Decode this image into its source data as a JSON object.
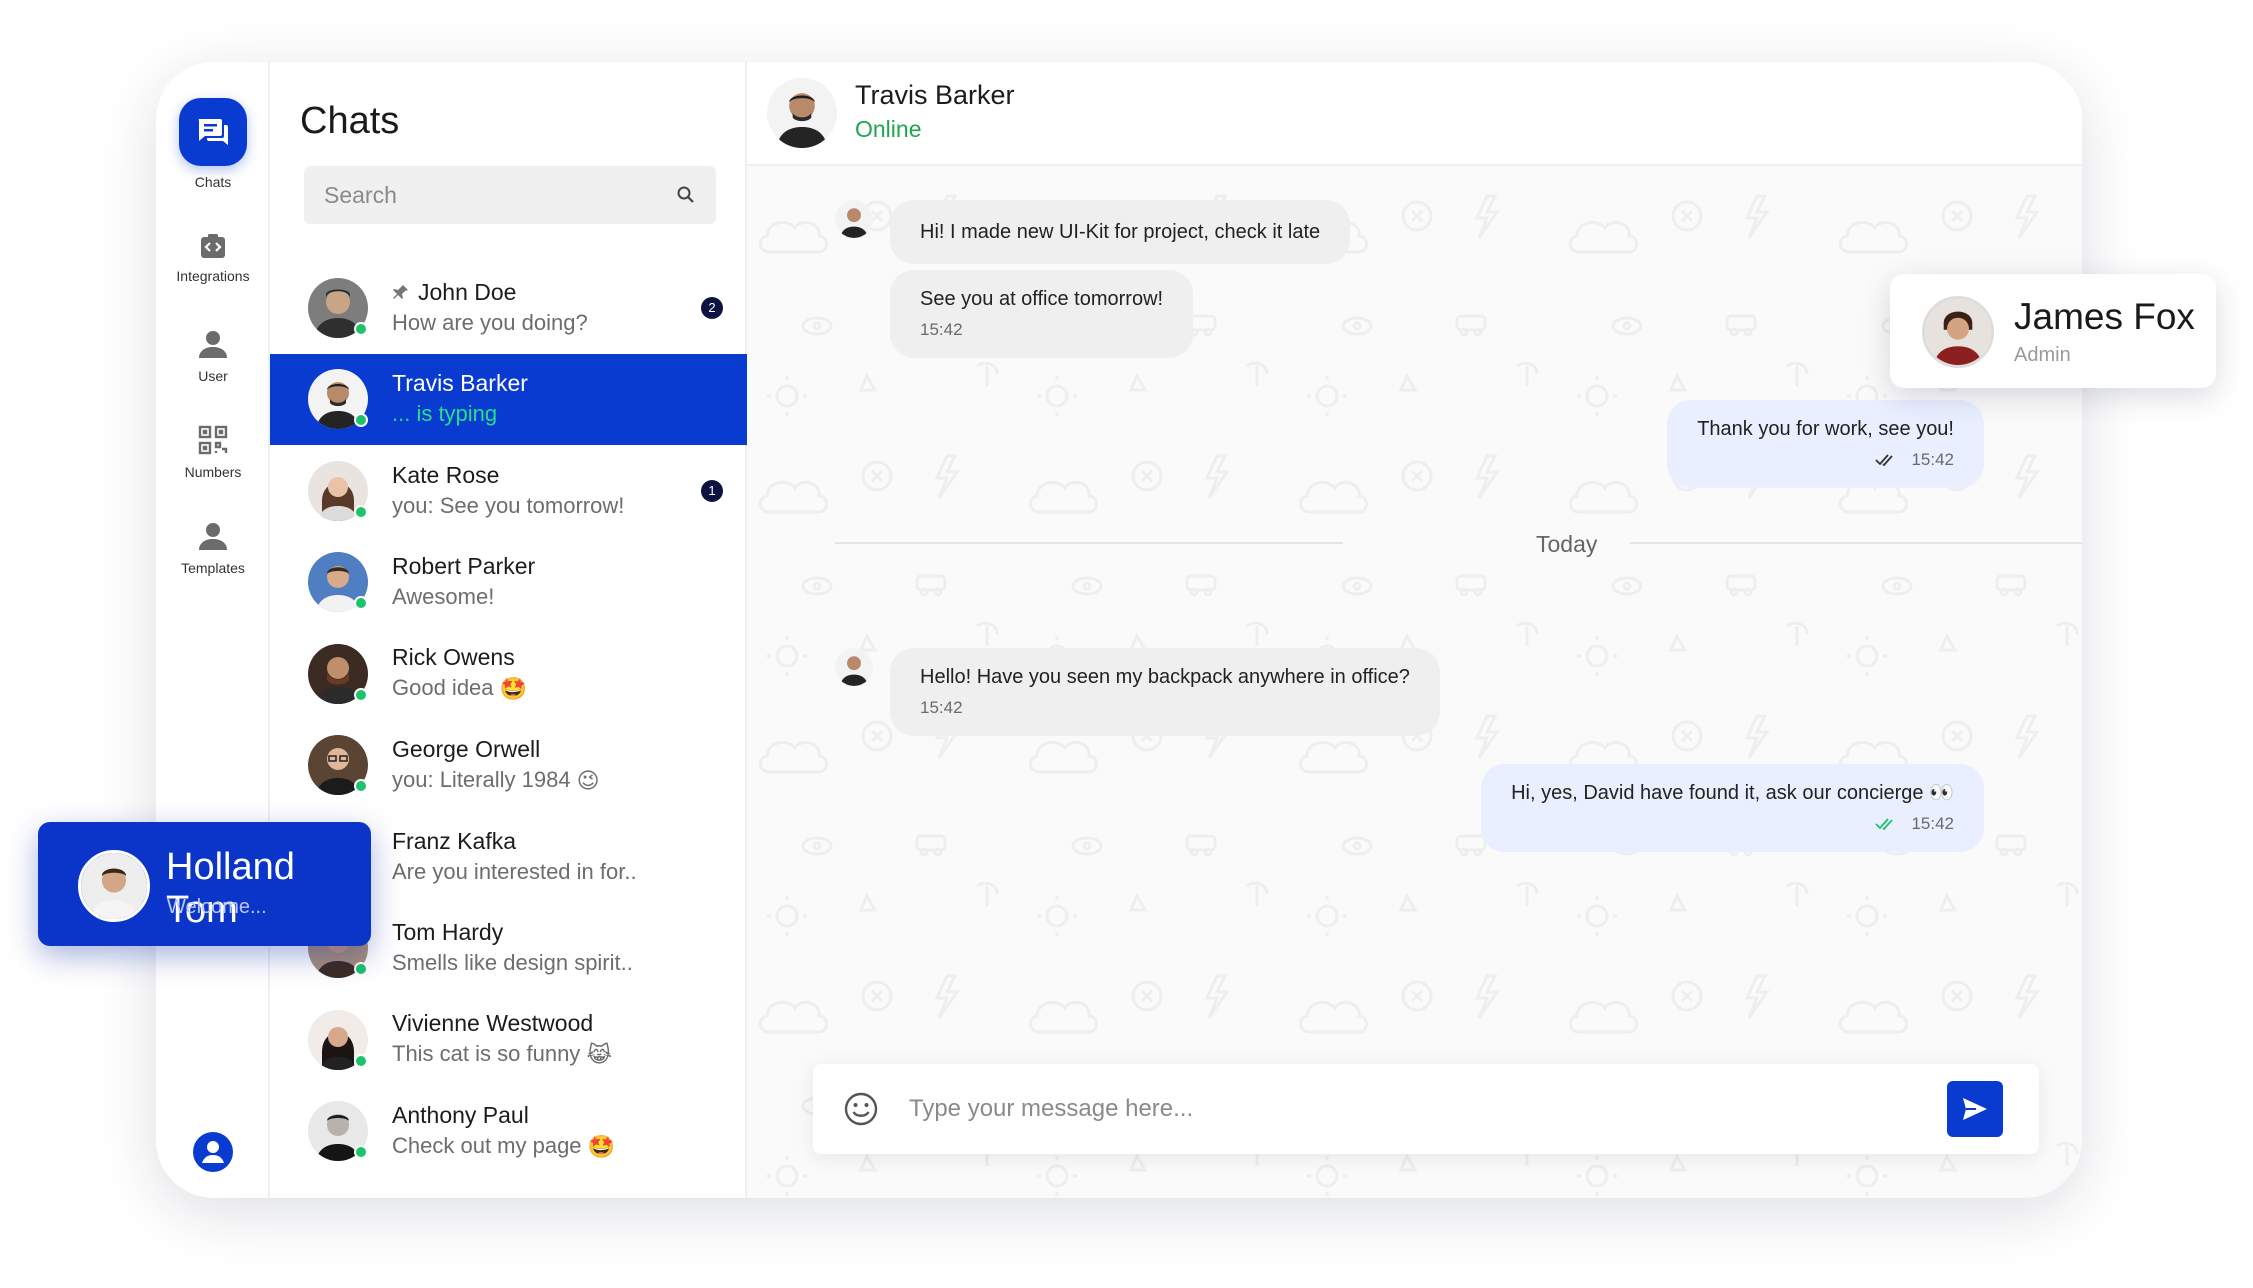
{
  "rail": {
    "items": [
      {
        "label": "Chats",
        "icon": "chat-bubbles-icon",
        "active": true
      },
      {
        "label": "Integrations",
        "icon": "code-box-icon"
      },
      {
        "label": "User",
        "icon": "user-icon"
      },
      {
        "label": "Numbers",
        "icon": "qr-code-icon"
      },
      {
        "label": "Templates",
        "icon": "user-icon"
      }
    ],
    "profile_icon": "account-circle-icon"
  },
  "chats": {
    "title": "Chats",
    "search_placeholder": "Search",
    "list": [
      {
        "name": "John Doe",
        "preview": "How are you doing?",
        "pinned": true,
        "badge": "2",
        "online": true,
        "emoji": ""
      },
      {
        "name": "Travis Barker",
        "preview": "... is typing",
        "active": true,
        "online": true,
        "emoji": ""
      },
      {
        "name": "Kate Rose",
        "preview": "you: See you tomorrow!",
        "badge": "1",
        "online": true,
        "emoji": ""
      },
      {
        "name": "Robert Parker",
        "preview": "Awesome!",
        "online": true,
        "emoji": ""
      },
      {
        "name": "Rick Owens",
        "preview": "Good idea",
        "online": true,
        "emoji": "🤩"
      },
      {
        "name": "George Orwell",
        "preview": "you: Literally 1984",
        "online": true,
        "emoji": "😉"
      },
      {
        "name": "Franz Kafka",
        "preview": "Are you interested in for..",
        "online": true,
        "emoji": ""
      },
      {
        "name": "Tom Hardy",
        "preview": "Smells like design spirit..",
        "online": true,
        "emoji": ""
      },
      {
        "name": "Vivienne Westwood",
        "preview": "This cat is so funny",
        "online": true,
        "emoji": "😹"
      },
      {
        "name": "Anthony Paul",
        "preview": "Check out my page",
        "online": true,
        "emoji": "🤩"
      }
    ]
  },
  "conversation": {
    "name": "Travis Barker",
    "status": "Online",
    "status_color": "#1fa552",
    "day_divider": "Today",
    "messages": [
      {
        "direction": "in",
        "text": "Hi! I made new UI-Kit for project, check it late",
        "time": ""
      },
      {
        "direction": "in",
        "text": "See you at office tomorrow!",
        "time": "15:42"
      },
      {
        "direction": "out",
        "text": "Thank you for work, see you!",
        "time": "15:42",
        "read": true
      },
      {
        "direction": "in",
        "text": "Hello! Have you seen my backpack anywhere in office?",
        "time": "15:42"
      },
      {
        "direction": "out",
        "text": "Hi, yes, David have found it, ask our concierge 👀",
        "time": "15:42",
        "read": true
      }
    ],
    "composer_placeholder": "Type your message here..."
  },
  "floating_cards": {
    "james": {
      "name": "James Fox",
      "role": "Admin"
    },
    "holland": {
      "name": "Holland Tom",
      "subtitle": "Welcome..."
    }
  },
  "colors": {
    "accent": "#0a3bd1",
    "online": "#1cc36a",
    "typing": "#22e08a",
    "bubble_in": "#efefef",
    "bubble_out": "#e9efff"
  }
}
